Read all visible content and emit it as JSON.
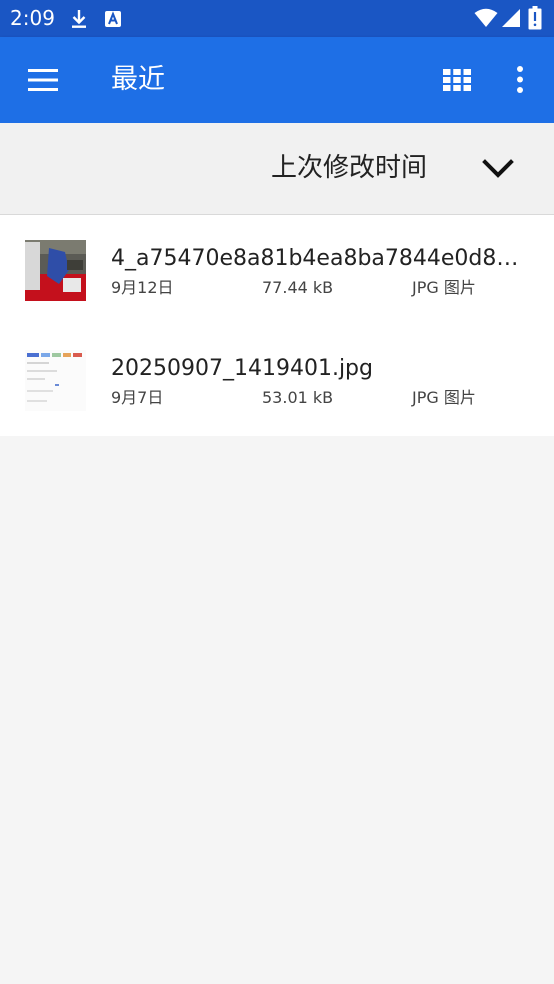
{
  "status_bar": {
    "time": "2:09",
    "icons": [
      "download-icon",
      "app-notification-icon",
      "wifi-icon",
      "cell-signal-icon",
      "battery-icon"
    ]
  },
  "app_bar": {
    "title": "最近",
    "menu_icon": "menu-icon",
    "grid_view_icon": "grid-view-icon",
    "more_icon": "more-vert-icon",
    "background_color": "#1e6fe6"
  },
  "sort": {
    "label": "上次修改时间",
    "icon": "chevron-down-icon"
  },
  "files": [
    {
      "name": "4_a75470e8a81b4ea8ba7844e0d80…",
      "date": "9月12日",
      "size": "77.44 kB",
      "type": "JPG 图片"
    },
    {
      "name": "20250907_1419401.jpg",
      "date": "9月7日",
      "size": "53.01 kB",
      "type": "JPG 图片"
    }
  ]
}
